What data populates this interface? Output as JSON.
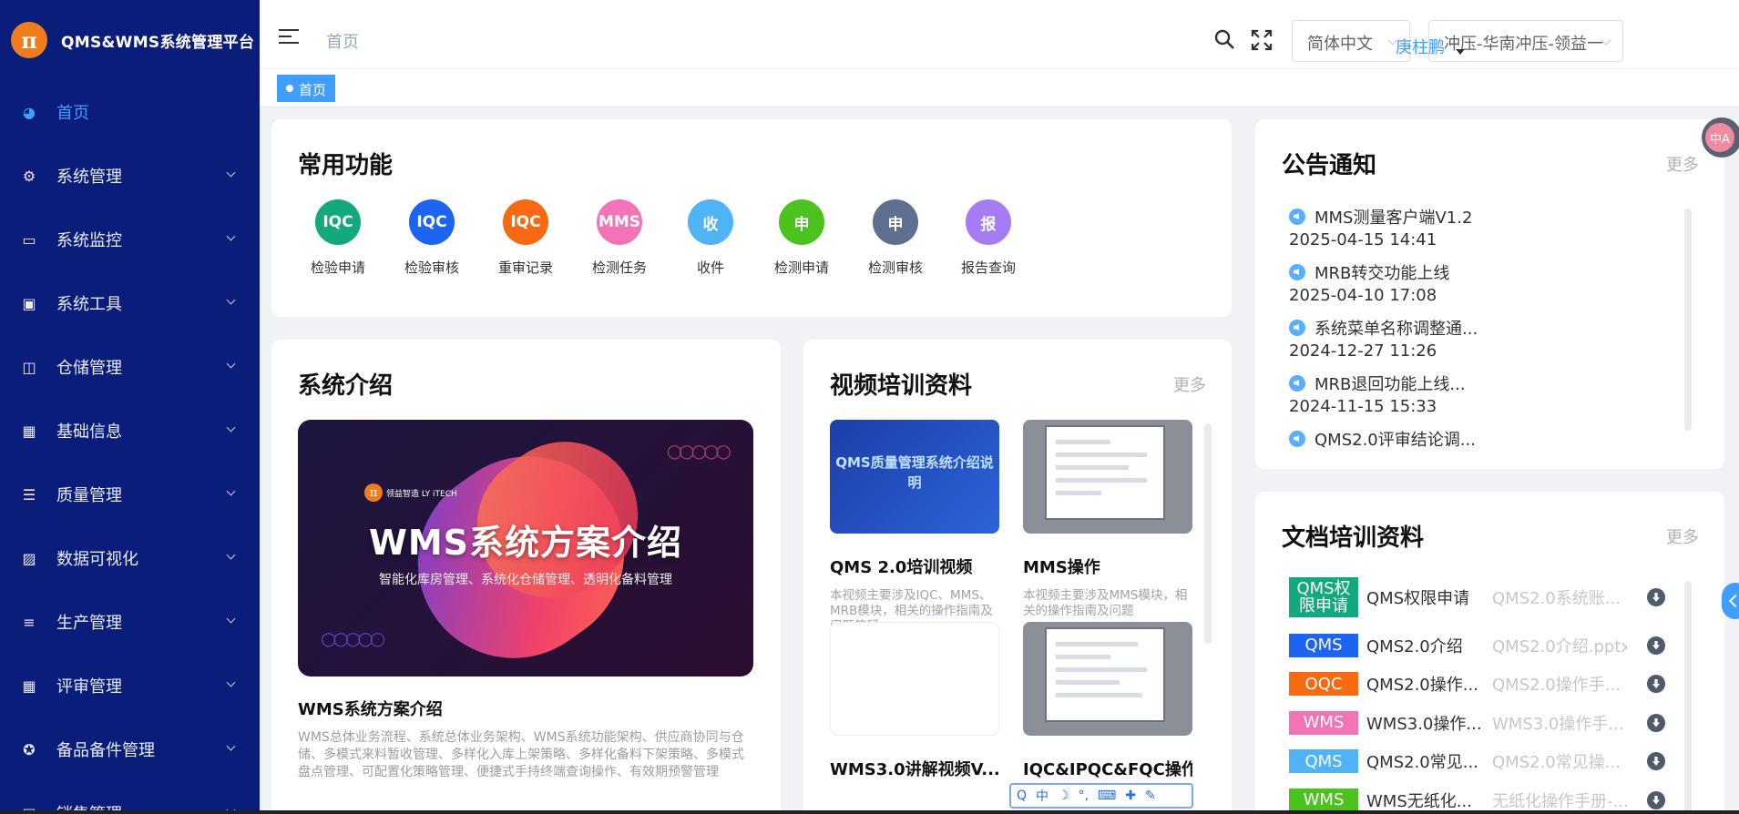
{
  "app": {
    "title": "QMS&WMS系统管理平台",
    "logo_char": "π"
  },
  "sidebar": {
    "items": [
      {
        "label": "首页",
        "icon": "dashboard-icon",
        "glyph": "◕",
        "active": true
      },
      {
        "label": "系统管理",
        "icon": "gear-icon",
        "glyph": "⚙"
      },
      {
        "label": "系统监控",
        "icon": "monitor-icon",
        "glyph": "▭"
      },
      {
        "label": "系统工具",
        "icon": "toolbox-icon",
        "glyph": "▣"
      },
      {
        "label": "仓储管理",
        "icon": "warehouse-icon",
        "glyph": "◫"
      },
      {
        "label": "基础信息",
        "icon": "table-icon",
        "glyph": "▦"
      },
      {
        "label": "质量管理",
        "icon": "sliders-icon",
        "glyph": "☰"
      },
      {
        "label": "数据可视化",
        "icon": "image-icon",
        "glyph": "▨"
      },
      {
        "label": "生产管理",
        "icon": "list-icon",
        "glyph": "≡"
      },
      {
        "label": "评审管理",
        "icon": "grid-icon",
        "glyph": "▦"
      },
      {
        "label": "备品备件管理",
        "icon": "cog-ring-icon",
        "glyph": "✪"
      },
      {
        "label": "销售管理",
        "icon": "sales-icon",
        "glyph": "▤"
      }
    ]
  },
  "header": {
    "breadcrumb": "首页",
    "language": "简体中文",
    "org": "冲压-华南冲压-领益一",
    "user": "庚柱鹏"
  },
  "tags": {
    "active": "首页"
  },
  "quick": {
    "title": "常用功能",
    "items": [
      {
        "badge": "IQC",
        "label": "检验申请",
        "color": "#13a87e"
      },
      {
        "badge": "IQC",
        "label": "检验审核",
        "color": "#1c64f2"
      },
      {
        "badge": "IQC",
        "label": "重审记录",
        "color": "#f86a12"
      },
      {
        "badge": "MMS",
        "label": "检测任务",
        "color": "#f472b6"
      },
      {
        "badge": "收",
        "label": "收件",
        "color": "#4fb3f6"
      },
      {
        "badge": "申",
        "label": "检测申请",
        "color": "#4cc21f"
      },
      {
        "badge": "申",
        "label": "检测审核",
        "color": "#5f6f8f"
      },
      {
        "badge": "报",
        "label": "报告查询",
        "color": "#a57cf4"
      }
    ]
  },
  "intro": {
    "title": "系统介绍",
    "banner_brand": "领益智造 LY iTECH",
    "banner_title": "WMS系统方案介绍",
    "banner_sub": "智能化库房管理、系统化仓储管理、透明化备料管理",
    "heading": "WMS系统方案介绍",
    "desc": "WMS总体业务流程、系统总体业务架构、WMS系统功能架构、供应商协同与仓储、多模式来料暂收管理、多样化入库上架策略、多样化备料下架策略、多模式盘点管理、可配置化策略管理、便捷式手持终端查询操作、有效期预警管理"
  },
  "video": {
    "title": "视频培训资料",
    "more": "更多",
    "items": [
      {
        "title": "QMS 2.0培训视频",
        "desc": "本视频主要涉及IQC、MMS、MRB模块，相关的操作指南及问题答疑。",
        "thumb_text": "QMS质量管理系统介绍说明"
      },
      {
        "title": "MMS操作",
        "desc": "本视频主要涉及MMS模块，相关的操作指南及问题"
      },
      {
        "title": "WMS3.0讲解视频V..."
      },
      {
        "title": "IQC&IPQC&FQC操作"
      }
    ]
  },
  "notice": {
    "title": "公告通知",
    "more": "更多",
    "items": [
      {
        "title": "MMS测量客户端V1.2",
        "date": "2025-04-15 14:41"
      },
      {
        "title": "MRB转交功能上线",
        "date": "2025-04-10 17:08"
      },
      {
        "title": "系统菜单名称调整通...",
        "date": "2024-12-27 11:26"
      },
      {
        "title": "MRB退回功能上线...",
        "date": "2024-11-15 15:33"
      },
      {
        "title": "QMS2.0评审结论调..."
      }
    ]
  },
  "docs": {
    "title": "文档培训资料",
    "more": "更多",
    "items": [
      {
        "badge": "QMS权限申请",
        "name": "QMS权限申请",
        "file": "QMS2.0系统账...",
        "color": "#13a87e"
      },
      {
        "badge": "QMS",
        "name": "QMS2.0介绍",
        "file": "QMS2.0介绍.pptx",
        "color": "#1c64f2"
      },
      {
        "badge": "OQC",
        "name": "QMS2.0操作...",
        "file": "QMS2.0操作手...",
        "color": "#f86a12"
      },
      {
        "badge": "WMS",
        "name": "WMS3.0操作...",
        "file": "WMS3.0操作手...",
        "color": "#f472b6"
      },
      {
        "badge": "QMS",
        "name": "QMS2.0常见...",
        "file": "QMS2.0常见操...",
        "color": "#4fb3f6"
      },
      {
        "badge": "WMS",
        "name": "WMS无纸化...",
        "file": "无纸化操作手册-...",
        "color": "#4cc21f"
      }
    ]
  },
  "ime": {
    "items": [
      "Q",
      "中",
      "☽",
      "°,",
      "⌨",
      "✚",
      "✎"
    ]
  },
  "translate_button": "中A"
}
